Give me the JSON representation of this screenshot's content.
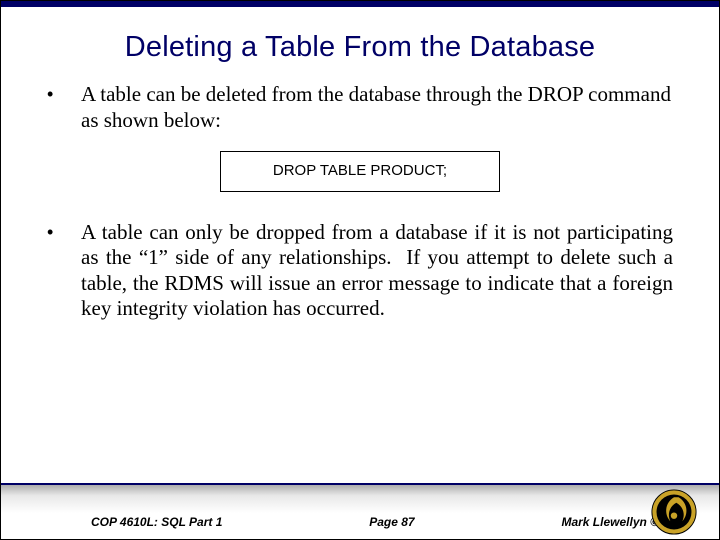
{
  "title": "Deleting a Table From the Database",
  "bullets": [
    "A table can be deleted from the database through the DROP command as shown below:",
    "A table can only be dropped from a database if it is not participating as the “1” side of any relationships.  If you attempt to delete such a table, the RDMS will issue an error message to indicate that a foreign key integrity violation has occurred."
  ],
  "code": "DROP TABLE PRODUCT;",
  "footer": {
    "course": "COP 4610L: SQL Part 1",
    "page": "Page 87",
    "author": "Mark Llewellyn ©"
  }
}
